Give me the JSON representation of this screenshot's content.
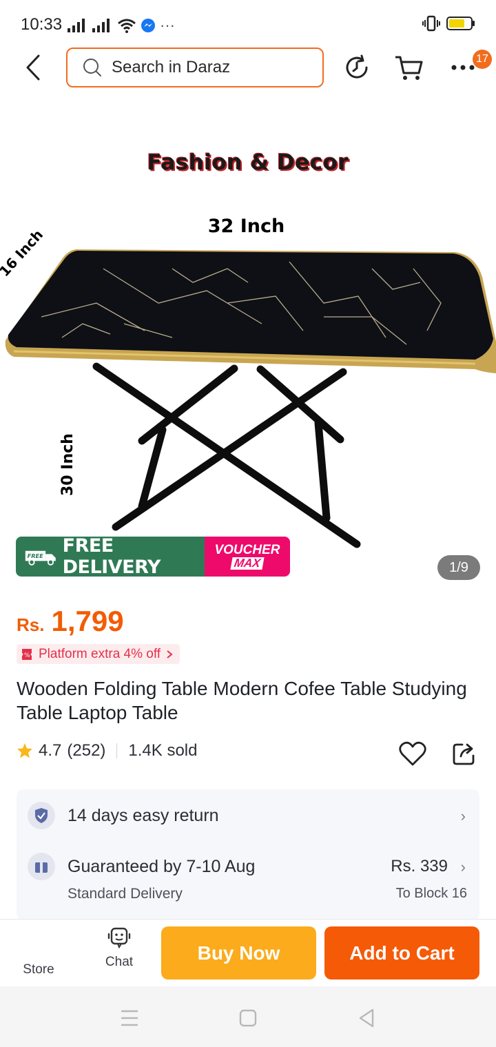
{
  "status_bar": {
    "time": "10:33",
    "dots": "···"
  },
  "header": {
    "search_placeholder": "Search in Daraz",
    "cart_badge": "17"
  },
  "gallery": {
    "brand": "Fashion & Decor",
    "dim_width": "32 Inch",
    "dim_depth": "16 Inch",
    "dim_height": "30 Inch",
    "promo_free_badge": "FREE",
    "promo_free_delivery": "FREE DELIVERY",
    "promo_voucher": "VOUCHER",
    "promo_max": "MAX",
    "counter": "1/9"
  },
  "product": {
    "currency": "Rs.",
    "price": "1,799",
    "platform_offer": "Platform extra 4% off",
    "title": "Wooden Folding Table Modern Cofee Table Studying Table Laptop Table",
    "rating": "4.7",
    "reviews": "(252)",
    "sold": "1.4K sold"
  },
  "info": {
    "return_text": "14 days easy return",
    "delivery_text": "Guaranteed by 7-10 Aug",
    "delivery_sub": "Standard Delivery",
    "delivery_price": "Rs. 339",
    "delivery_location": "To Block 16"
  },
  "bottom_bar": {
    "store_label": "Store",
    "chat_label": "Chat",
    "buy_now": "Buy Now",
    "add_to_cart": "Add to Cart"
  },
  "colors": {
    "accent": "#f26c1d",
    "price": "#f25c05",
    "buy_now": "#fbab1b",
    "add_to_cart": "#f55a06",
    "free_delivery": "#2f7a55",
    "voucher": "#ee0a6b"
  }
}
